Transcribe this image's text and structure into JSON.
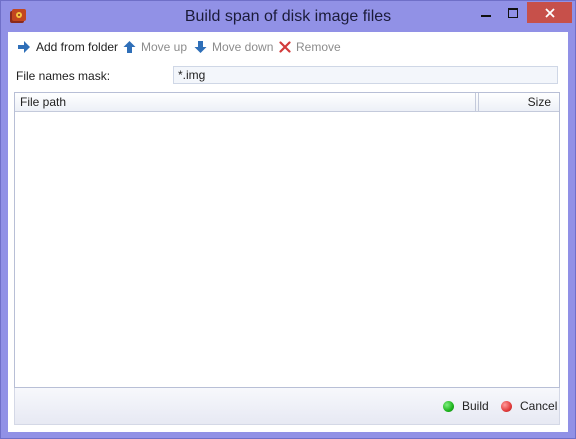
{
  "window": {
    "title": "Build span of disk image files",
    "app_icon": "disk-image-app-icon",
    "controls": [
      "minimize-icon",
      "maximize-icon",
      "close-icon"
    ]
  },
  "toolbar": {
    "add_from_folder": {
      "label": "Add from folder",
      "icon": "arrow-right-icon",
      "enabled": true
    },
    "move_up": {
      "label": "Move up",
      "icon": "arrow-up-icon",
      "enabled": false
    },
    "move_down": {
      "label": "Move down",
      "icon": "arrow-down-icon",
      "enabled": false
    },
    "remove": {
      "label": "Remove",
      "icon": "remove-x-icon",
      "enabled": false
    }
  },
  "mask": {
    "label": "File names mask:",
    "value": "*.img"
  },
  "grid": {
    "columns": [
      "File path",
      "Size"
    ],
    "rows": []
  },
  "footer": {
    "build": {
      "label": "Build",
      "icon": "green-dot-icon"
    },
    "cancel": {
      "label": "Cancel",
      "icon": "red-dot-icon"
    }
  },
  "colors": {
    "frame": "#9191e6",
    "close_button": "#c7504a",
    "accent_arrow": "#2f6fb8",
    "remove_x": "#d23b3b",
    "build_dot": "#1db31d",
    "cancel_dot": "#e23c3c"
  }
}
